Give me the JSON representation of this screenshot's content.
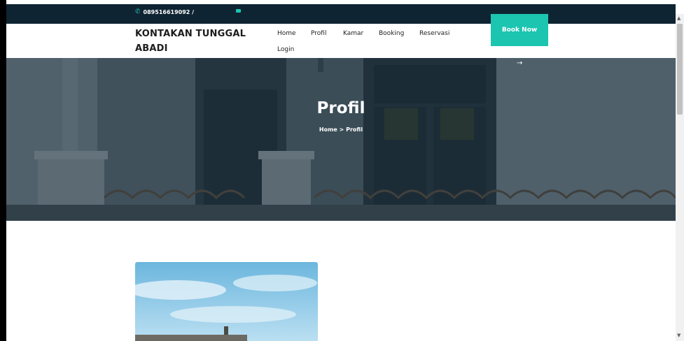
{
  "topbar": {
    "phone": "089516619092 /",
    "phone_icon": "phone-icon",
    "mail_icon": "envelope-icon",
    "background": "#0f2432",
    "accent": "#1bc5b0"
  },
  "brand": {
    "line1": "KONTAKAN TUNGGAL",
    "line2": "ABADI"
  },
  "nav": {
    "home": "Home",
    "profil": "Profil",
    "kamar": "Kamar",
    "booking": "Booking",
    "reservasi": "Reservasi",
    "login": "Login"
  },
  "cta": {
    "book_now": "Book Now",
    "arrow": "→",
    "color": "#1bc5b0"
  },
  "hero": {
    "title": "Profil",
    "breadcrumb": "Home > Profil"
  },
  "scrollbar": {
    "up": "▲",
    "down": "▼"
  }
}
